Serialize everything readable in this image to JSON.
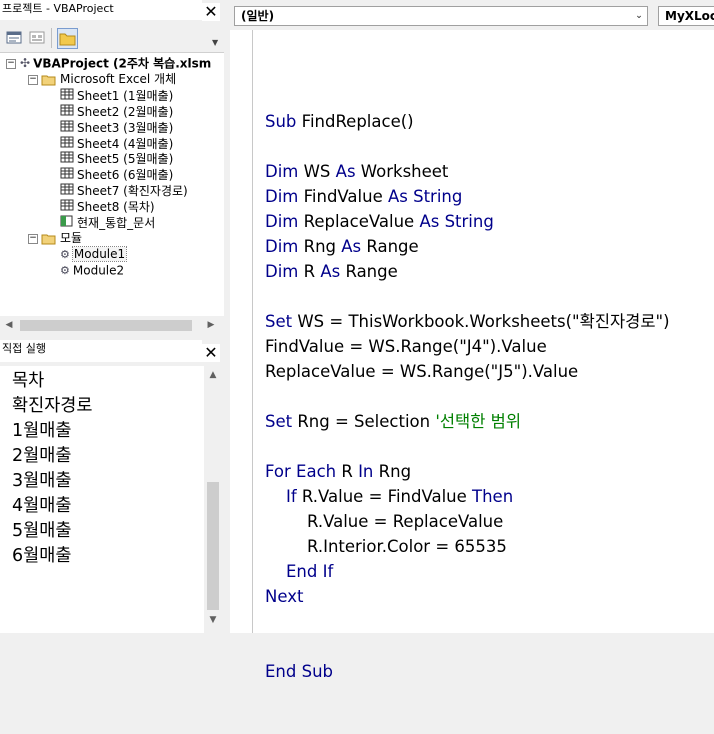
{
  "project": {
    "title": "프로젝트 - VBAProject",
    "root": "VBAProject (2주차 복습.xlsm",
    "excel_folder": "Microsoft Excel 개체",
    "sheets": [
      "Sheet1 (1월매출)",
      "Sheet2 (2월매출)",
      "Sheet3 (3월매출)",
      "Sheet4 (4월매출)",
      "Sheet5 (5월매출)",
      "Sheet6 (6월매출)",
      "Sheet7 (확진자경로)",
      "Sheet8 (목차)",
      "현재_통합_문서"
    ],
    "modules_folder": "모듈",
    "modules": [
      "Module1",
      "Module2"
    ],
    "selected": "Module1"
  },
  "immediate": {
    "title": "직접 실행",
    "lines": [
      "목차",
      "확진자경로",
      "1월매출",
      "2월매출",
      "3월매출",
      "4월매출",
      "5월매출",
      "6월매출"
    ]
  },
  "editor": {
    "object_combo": "(일반)",
    "procedure_combo": "MyXLoc",
    "code_lines": [
      [],
      [
        {
          "k": "kw",
          "t": "Sub "
        },
        {
          "k": "n",
          "t": "FindReplace()"
        }
      ],
      [],
      [
        {
          "k": "kw",
          "t": "Dim "
        },
        {
          "k": "n",
          "t": "WS "
        },
        {
          "k": "kw",
          "t": "As "
        },
        {
          "k": "n",
          "t": "Worksheet"
        }
      ],
      [
        {
          "k": "kw",
          "t": "Dim "
        },
        {
          "k": "n",
          "t": "FindValue "
        },
        {
          "k": "kw",
          "t": "As String"
        }
      ],
      [
        {
          "k": "kw",
          "t": "Dim "
        },
        {
          "k": "n",
          "t": "ReplaceValue "
        },
        {
          "k": "kw",
          "t": "As String"
        }
      ],
      [
        {
          "k": "kw",
          "t": "Dim "
        },
        {
          "k": "n",
          "t": "Rng "
        },
        {
          "k": "kw",
          "t": "As "
        },
        {
          "k": "n",
          "t": "Range"
        }
      ],
      [
        {
          "k": "kw",
          "t": "Dim "
        },
        {
          "k": "n",
          "t": "R "
        },
        {
          "k": "kw",
          "t": "As "
        },
        {
          "k": "n",
          "t": "Range"
        }
      ],
      [],
      [
        {
          "k": "kw",
          "t": "Set "
        },
        {
          "k": "n",
          "t": "WS = ThisWorkbook.Worksheets(\"확진자경로\")"
        }
      ],
      [
        {
          "k": "n",
          "t": "FindValue = WS.Range(\"J4\").Value"
        }
      ],
      [
        {
          "k": "n",
          "t": "ReplaceValue = WS.Range(\"J5\").Value"
        }
      ],
      [],
      [
        {
          "k": "kw",
          "t": "Set "
        },
        {
          "k": "n",
          "t": "Rng = Selection "
        },
        {
          "k": "cm",
          "t": "'선택한 범위"
        }
      ],
      [],
      [
        {
          "k": "kw",
          "t": "For Each "
        },
        {
          "k": "n",
          "t": "R "
        },
        {
          "k": "kw",
          "t": "In "
        },
        {
          "k": "n",
          "t": "Rng"
        }
      ],
      [
        {
          "k": "n",
          "t": "    "
        },
        {
          "k": "kw",
          "t": "If "
        },
        {
          "k": "n",
          "t": "R.Value = FindValue "
        },
        {
          "k": "kw",
          "t": "Then"
        }
      ],
      [
        {
          "k": "n",
          "t": "        R.Value = ReplaceValue"
        }
      ],
      [
        {
          "k": "n",
          "t": "        R.Interior.Color = 65535"
        }
      ],
      [
        {
          "k": "n",
          "t": "    "
        },
        {
          "k": "kw",
          "t": "End If"
        }
      ],
      [
        {
          "k": "kw",
          "t": "Next"
        }
      ],
      [],
      [],
      [
        {
          "k": "kw",
          "t": "End Sub"
        }
      ]
    ]
  },
  "icons": {
    "close": "close-icon",
    "view_code": "view-code-icon",
    "view_object": "view-object-icon",
    "toggle_folders": "folder-icon"
  },
  "colors": {
    "keyword": "#00008b",
    "comment": "#008000",
    "text": "#000000"
  }
}
